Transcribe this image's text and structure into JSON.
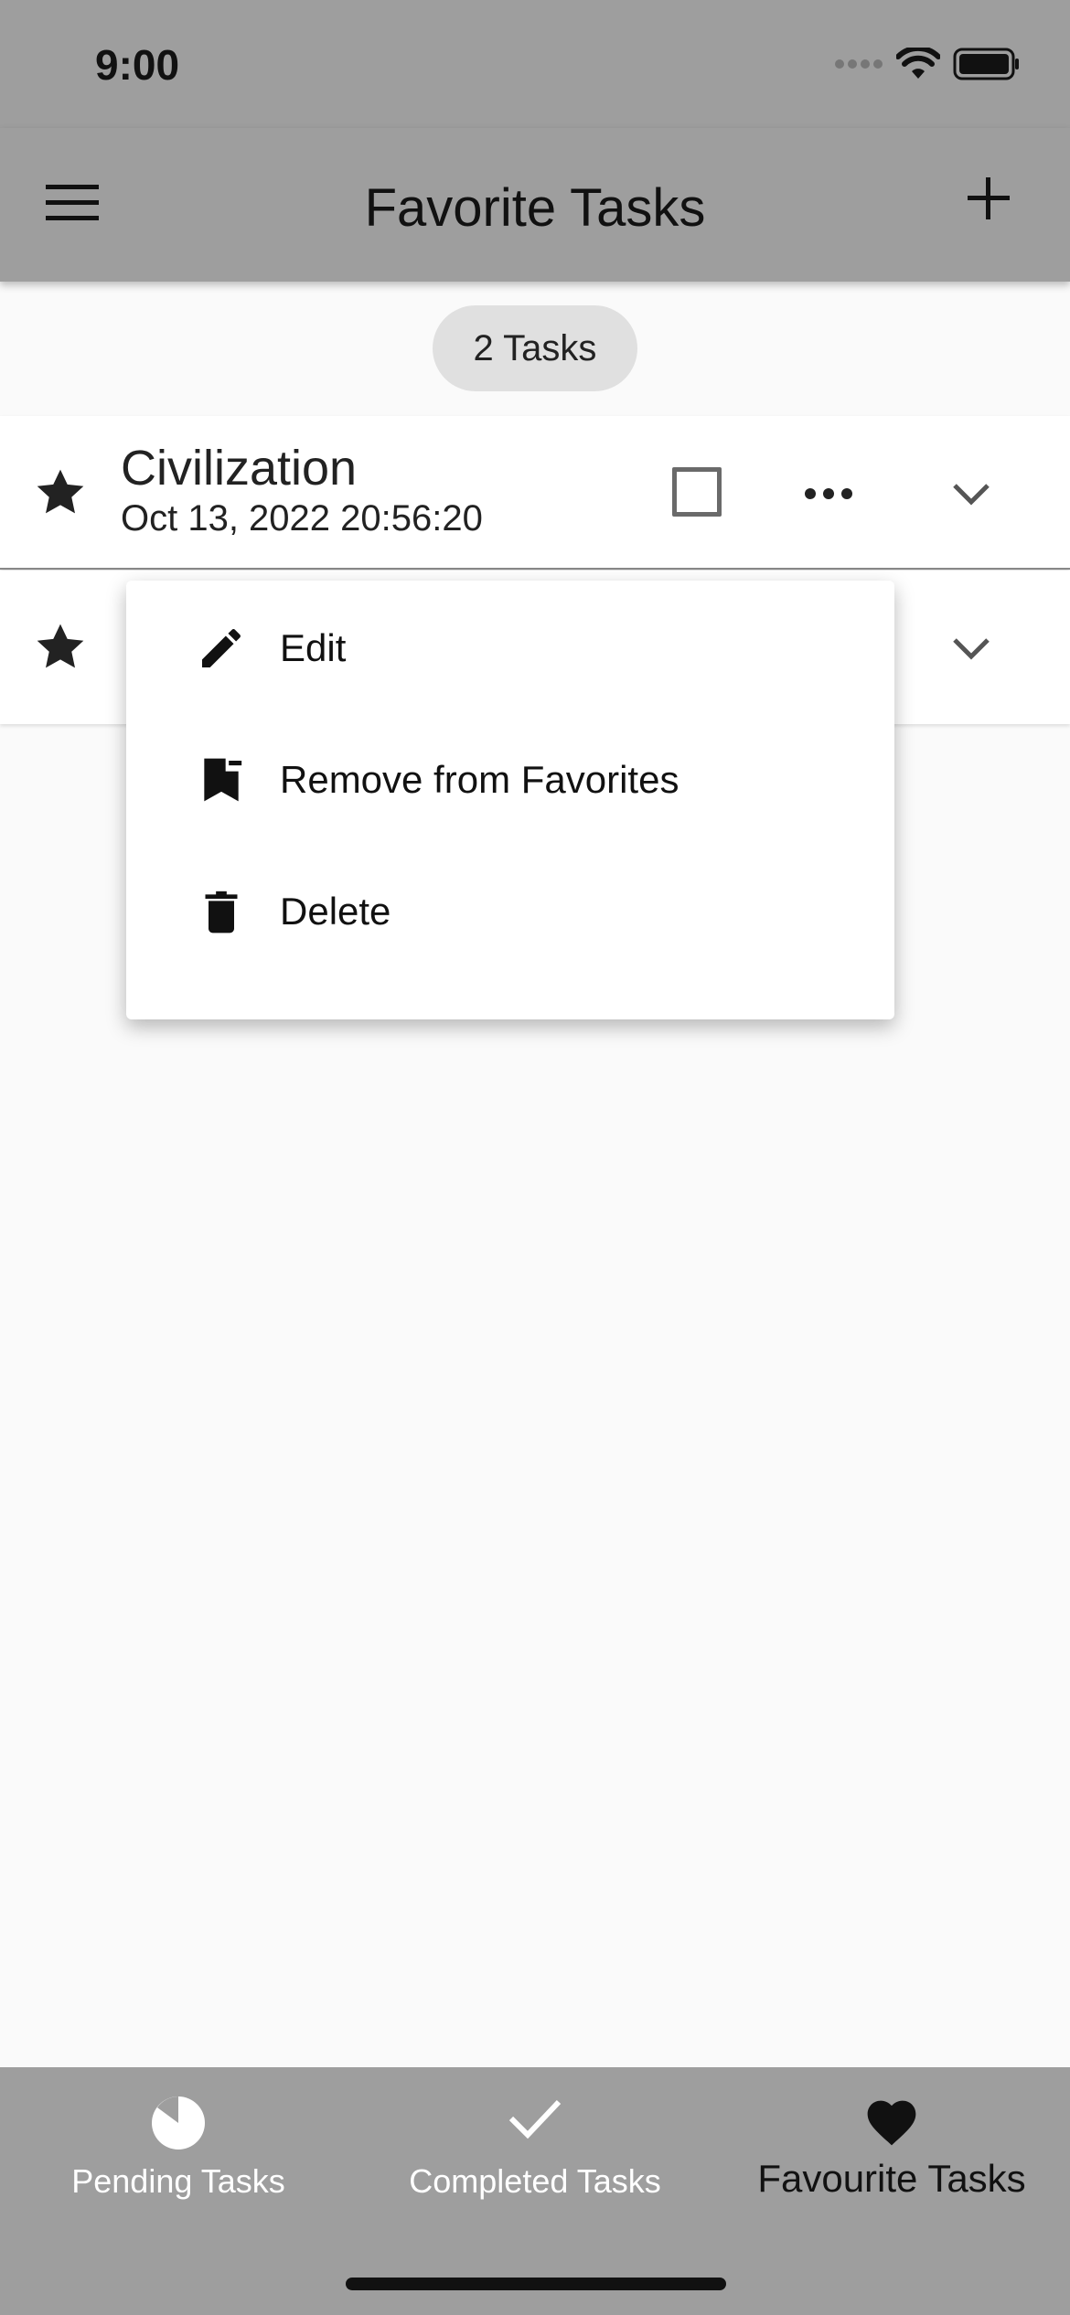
{
  "status_bar": {
    "time": "9:00"
  },
  "app_bar": {
    "title": "Favorite Tasks"
  },
  "task_count": "2 Tasks",
  "tasks": [
    {
      "title": "Civilization",
      "date": "Oct 13, 2022 20:56:20",
      "favorite": true,
      "completed": false
    },
    {
      "title": "",
      "date": "",
      "favorite": true,
      "completed": false
    }
  ],
  "popup_menu": {
    "items": [
      {
        "label": "Edit",
        "icon": "pencil-icon"
      },
      {
        "label": "Remove from Favorites",
        "icon": "bookmark-remove-icon"
      },
      {
        "label": "Delete",
        "icon": "trash-icon"
      }
    ]
  },
  "bottom_nav": {
    "items": [
      {
        "label": "Pending Tasks",
        "icon": "pie-clock-icon"
      },
      {
        "label": "Completed Tasks",
        "icon": "check-icon"
      },
      {
        "label": "Favourite Tasks",
        "icon": "heart-icon",
        "active": true
      }
    ]
  },
  "colors": {
    "bar": "#9e9e9e",
    "background": "#fafafa",
    "chip": "#e0e0e0"
  }
}
